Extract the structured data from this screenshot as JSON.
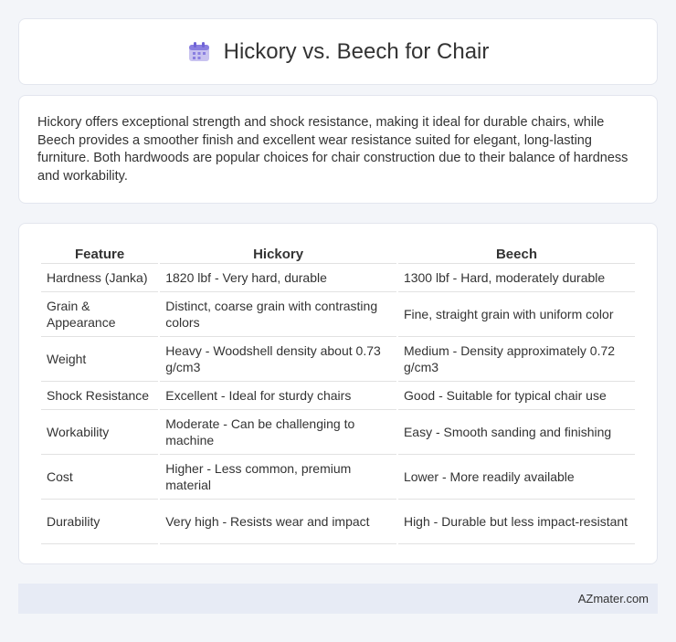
{
  "header": {
    "title": "Hickory vs. Beech for Chair",
    "icon": "calendar-icon"
  },
  "intro": {
    "text": "Hickory offers exceptional strength and shock resistance, making it ideal for durable chairs, while Beech provides a smoother finish and excellent wear resistance suited for elegant, long-lasting furniture. Both hardwoods are popular choices for chair construction due to their balance of hardness and workability."
  },
  "table": {
    "headers": [
      "Feature",
      "Hickory",
      "Beech"
    ],
    "rows": [
      [
        "Hardness (Janka)",
        "1820 lbf - Very hard, durable",
        "1300 lbf - Hard, moderately durable"
      ],
      [
        "Grain & Appearance",
        "Distinct, coarse grain with contrasting colors",
        "Fine, straight grain with uniform color"
      ],
      [
        "Weight",
        "Heavy - Woodshell density about 0.73 g/cm3",
        "Medium - Density approximately 0.72 g/cm3"
      ],
      [
        "Shock Resistance",
        "Excellent - Ideal for sturdy chairs",
        "Good - Suitable for typical chair use"
      ],
      [
        "Workability",
        "Moderate - Can be challenging to machine",
        "Easy - Smooth sanding and finishing"
      ],
      [
        "Cost",
        "Higher - Less common, premium material",
        "Lower - More readily available"
      ],
      [
        "Durability",
        "Very high - Resists wear and impact",
        "High - Durable but less impact-resistant"
      ]
    ]
  },
  "footer": {
    "text": "AZmater.com"
  }
}
